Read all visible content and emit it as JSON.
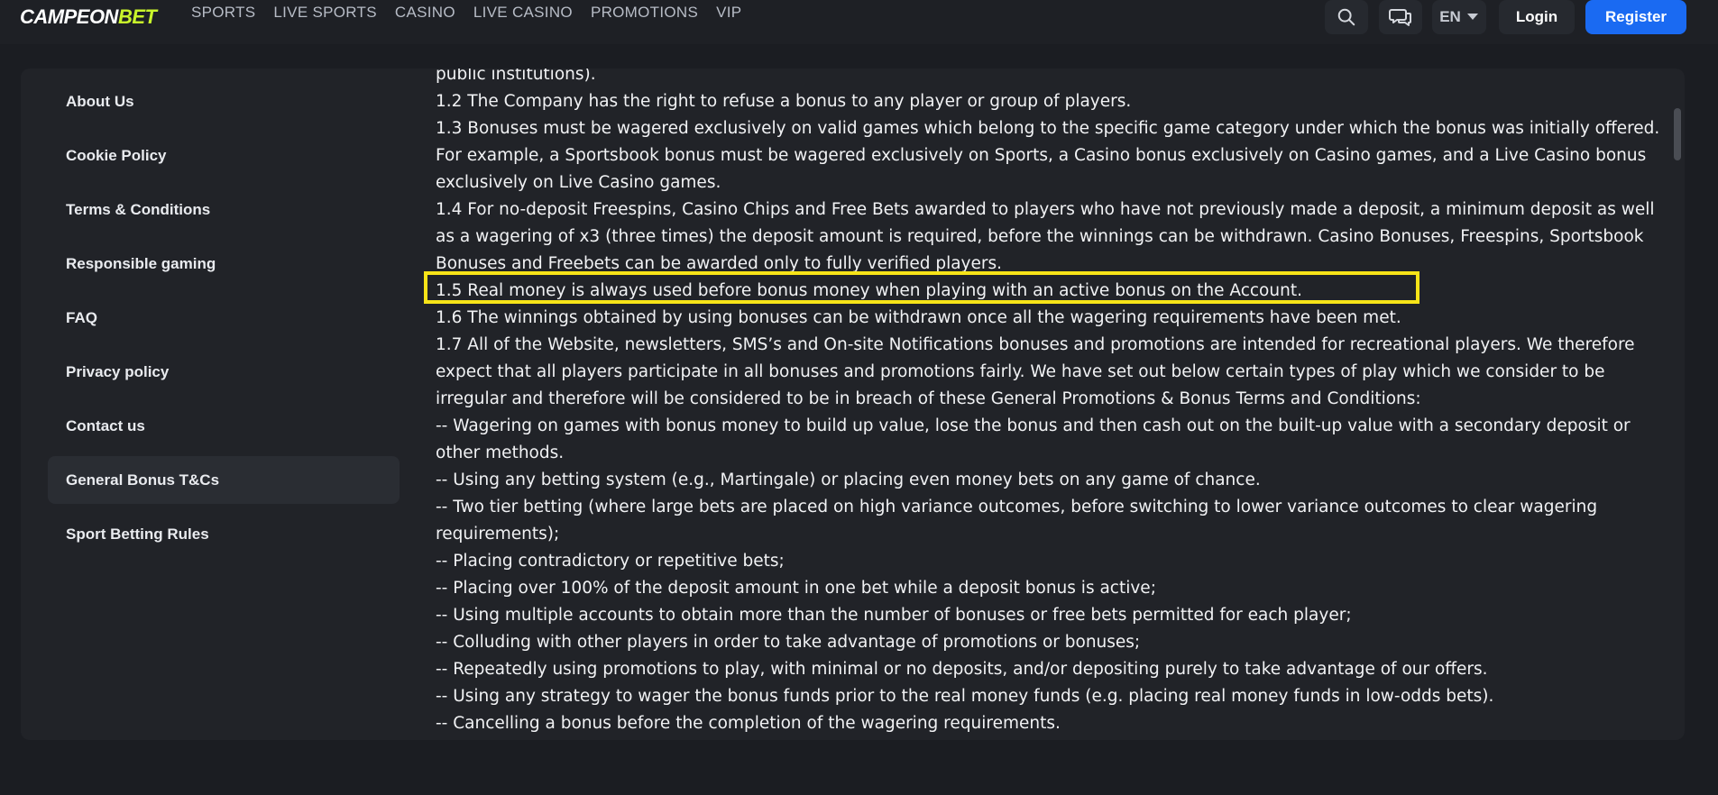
{
  "header": {
    "logo": {
      "main": "CAMPEON",
      "accent": "BET"
    },
    "nav": [
      "SPORTS",
      "LIVE SPORTS",
      "CASINO",
      "LIVE CASINO",
      "PROMOTIONS",
      "VIP"
    ],
    "language": "EN",
    "login_label": "Login",
    "register_label": "Register"
  },
  "sidebar": {
    "items": [
      "About Us",
      "Cookie Policy",
      "Terms & Conditions",
      "Responsible gaming",
      "FAQ",
      "Privacy policy",
      "Contact us",
      "General Bonus T&Cs",
      "Sport Betting Rules"
    ],
    "active": "General Bonus T&Cs"
  },
  "content": {
    "paragraphs": [
      "public institutions).",
      "1.2 The Company has the right to refuse a bonus to any player or group of players.",
      "1.3 Bonuses must be wagered exclusively on valid games which belong to the specific game category under which the bonus was initially offered. For example, a Sportsbook bonus must be wagered exclusively on Sports, a Casino bonus exclusively on Casino games, and a Live Casino bonus exclusively on Live Casino games.",
      "1.4 For no-deposit Freespins, Casino Chips and Free Bets awarded to players who have not previously made a deposit, a minimum deposit as well as a wagering of x3 (three times) the deposit amount is required, before the winnings can be withdrawn. Casino Bonuses, Freespins, Sportsbook Bonuses and Freebets can be awarded only to fully verified players.",
      "1.5 Real money is always used before bonus money when playing with an active bonus on the Account.",
      "1.6 The winnings obtained by using bonuses can be withdrawn once all the wagering requirements have been met.",
      "1.7 All of the Website, newsletters, SMS’s and On-site Notifications bonuses and promotions are intended for recreational players. We therefore expect that all players participate in all bonuses and promotions fairly. We have set out below certain types of play which we consider to be irregular and therefore will be considered to be in breach of these General Promotions & Bonus Terms and Conditions:",
      "-- Wagering on games with bonus money to build up value, lose the bonus and then cash out on the built-up value with a secondary deposit or other methods.",
      "-- Using any betting system (e.g., Martingale) or placing even money bets on any game of chance.",
      "-- Two tier betting (where large bets are placed on high variance outcomes, before switching to lower variance outcomes to clear wagering requirements);",
      "-- Placing contradictory or repetitive bets;",
      "-- Placing over 100% of the deposit amount in one bet while a deposit bonus is active;",
      "-- Using multiple accounts to obtain more than the number of bonuses or free bets permitted for each player;",
      "-- Colluding with other players in order to take advantage of promotions or bonuses;",
      "-- Repeatedly using promotions to play, with minimal or no deposits, and/or depositing purely to take advantage of our offers.",
      "-- Using any strategy to wager the bonus funds prior to the real money funds (e.g. placing real money funds in low-odds bets).",
      "-- Cancelling a bonus before the completion of the wagering requirements."
    ],
    "highlighted_index": 4
  },
  "colors": {
    "background": "#1b1d22",
    "panel": "#212328",
    "accent_blue": "#1a6af2",
    "logo_accent": "#c9f52b",
    "highlight_border": "#f7e418"
  },
  "icons": [
    "search-icon",
    "chat-icon",
    "chevron-down-icon"
  ]
}
